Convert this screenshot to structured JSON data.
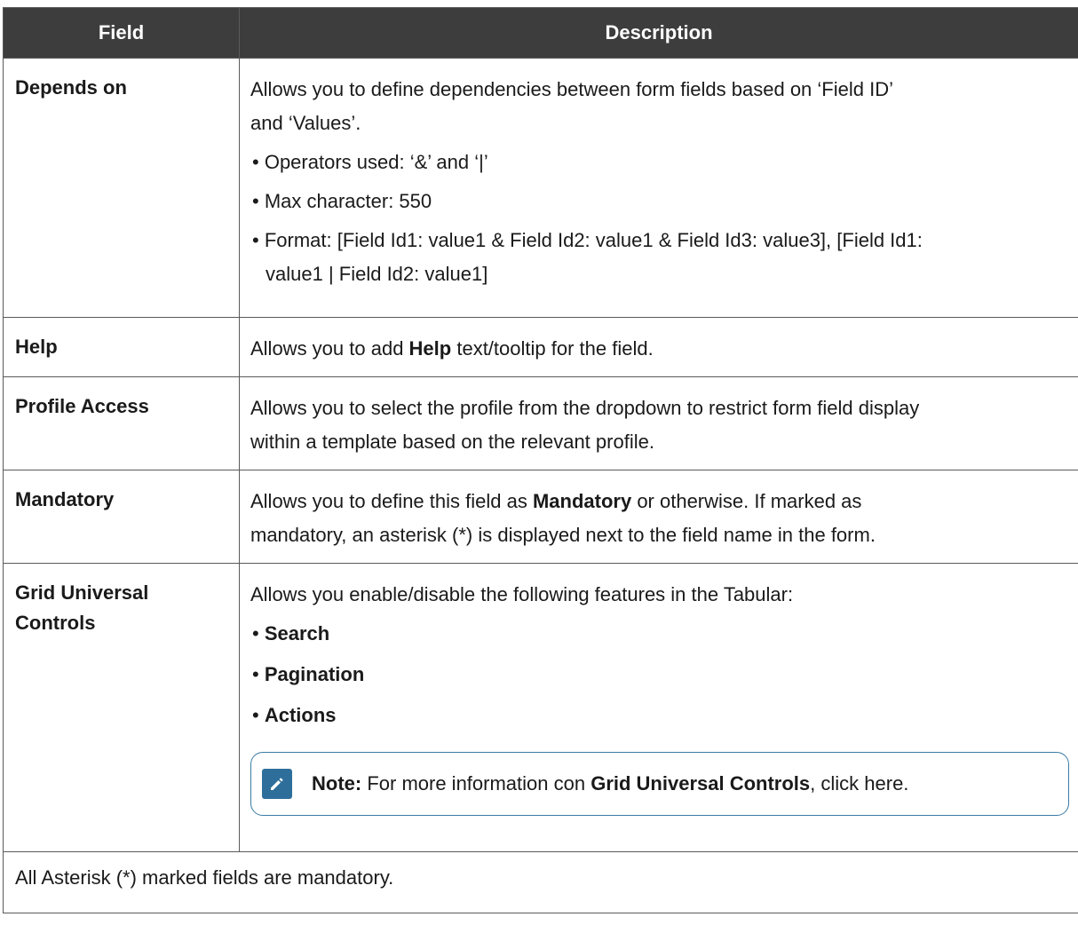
{
  "table": {
    "headers": [
      "Field",
      "Description"
    ],
    "rows": [
      {
        "field": "Depends on",
        "desc_lines": [
          "Allows you to define dependencies between form fields based on ‘Field ID’",
          "and ‘Values’."
        ],
        "bullets": [
          "Operators used: ‘&’ and ‘|’",
          "Max character: 550",
          "Format: [Field Id1: value1 & Field Id2: value1 & Field Id3: value3], [Field Id1:"
        ],
        "bullet_continuation": "value1 | Field Id2: value1]"
      },
      {
        "field": "Help",
        "desc_pre": "Allows you to add ",
        "desc_bold": "Help",
        "desc_post": " text/tooltip for the field."
      },
      {
        "field": "Profile Access",
        "desc_lines": [
          "Allows you to select the profile from the dropdown to restrict form field display",
          "within a template based on the relevant profile."
        ]
      },
      {
        "field": "Mandatory",
        "desc_pre": "Allows you to define this field as ",
        "desc_bold": "Mandatory",
        "desc_post": " or otherwise. If marked as",
        "desc_line2": "mandatory, an asterisk (*) is displayed next to the field name in the form."
      },
      {
        "field_line1": "Grid Universal",
        "field_line2": "Controls",
        "desc_intro": "Allows you enable/disable the following features in the Tabular:",
        "bullets": [
          "Search",
          "Pagination",
          "Actions"
        ],
        "note": {
          "icon": "pencil-edit-icon",
          "label": "Note:",
          "pre": " For more information con ",
          "bold": "Grid Universal Controls",
          "post": ", click here."
        }
      }
    ],
    "footer": "All Asterisk (*) marked fields are mandatory."
  },
  "colors": {
    "header_bg": "#3d3d3d",
    "header_text": "#ffffff",
    "note_border": "#3a7ca5",
    "note_icon_bg": "#2d6f9a"
  }
}
